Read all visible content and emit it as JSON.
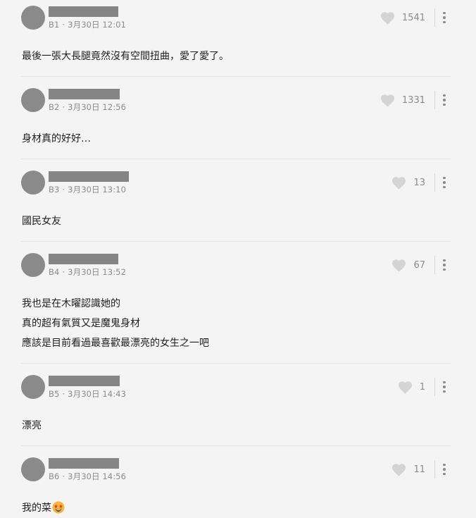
{
  "comments": [
    {
      "floor": "B1",
      "date": "3月30日 12:01",
      "likes": "1541",
      "lines": [
        "最後一張大長腿竟然沒有空間扭曲，愛了愛了。"
      ]
    },
    {
      "floor": "B2",
      "date": "3月30日 12:56",
      "likes": "1331",
      "lines": [
        "身材真的好好…"
      ]
    },
    {
      "floor": "B3",
      "date": "3月30日 13:10",
      "likes": "13",
      "lines": [
        "國民女友"
      ]
    },
    {
      "floor": "B4",
      "date": "3月30日 13:52",
      "likes": "67",
      "lines": [
        "我也是在木曜認識她的",
        "真的超有氣質又是魔鬼身材",
        "應該是目前看過最喜歡最漂亮的女生之一吧"
      ]
    },
    {
      "floor": "B5",
      "date": "3月30日 14:43",
      "likes": "1",
      "lines": [
        "漂亮"
      ]
    },
    {
      "floor": "B6",
      "date": "3月30日 14:56",
      "likes": "11",
      "lines": [
        "我的菜"
      ],
      "emoji": "star-struck-emoji"
    }
  ],
  "colors": {
    "background": "#f4f4f4",
    "avatar": "#8a8a8a",
    "redaction": "#858585",
    "muted": "#8c8c8c",
    "heart": "#d4d4d4",
    "emoji_face": "#f7b733",
    "emoji_star": "#e53935"
  }
}
